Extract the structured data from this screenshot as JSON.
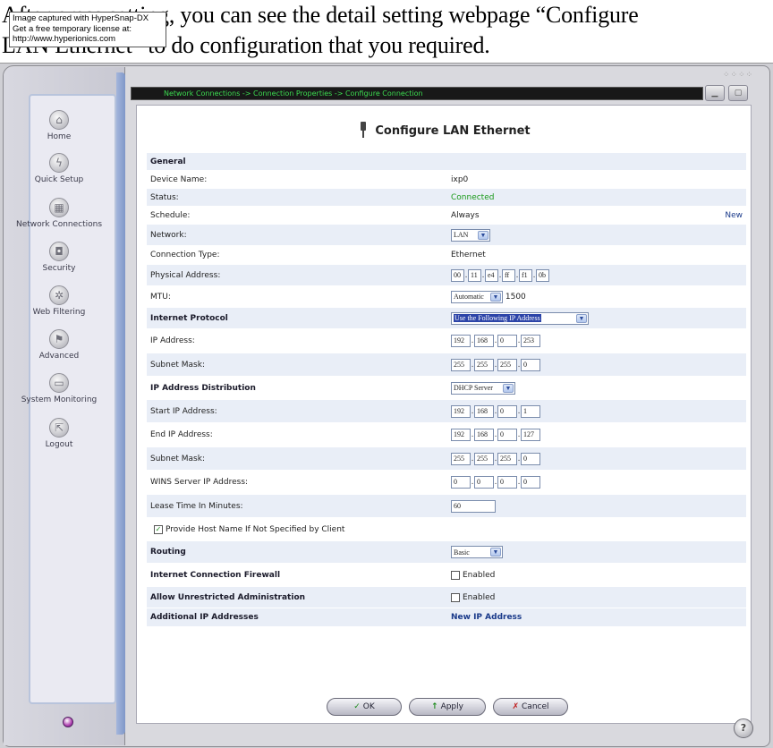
{
  "intro": {
    "line1": "After press setting, you can see the detail setting webpage “Configure",
    "line2": "LAN Ethernet” to do configuration that you required."
  },
  "watermark": {
    "line1": "Image captured with HyperSnap-DX",
    "line2": "Get a free temporary license at:",
    "line3": "http://www.hyperionics.com"
  },
  "breadcrumb": "Network Connections -> Connection Properties -> Configure Connection",
  "sidebar": {
    "items": [
      {
        "label": "Home",
        "icon": "home-icon"
      },
      {
        "label": "Quick Setup",
        "icon": "lightning-icon"
      },
      {
        "label": "Network Connections",
        "icon": "network-icon"
      },
      {
        "label": "Security",
        "icon": "lock-icon"
      },
      {
        "label": "Web Filtering",
        "icon": "filter-icon"
      },
      {
        "label": "Advanced",
        "icon": "advanced-icon"
      },
      {
        "label": "System Monitoring",
        "icon": "monitor-icon"
      },
      {
        "label": "Logout",
        "icon": "logout-icon"
      }
    ]
  },
  "page_title": "Configure LAN Ethernet",
  "form": {
    "general": "General",
    "device_name_label": "Device Name:",
    "device_name_value": "ixp0",
    "status_label": "Status:",
    "status_value": "Connected",
    "schedule_label": "Schedule:",
    "schedule_value": "Always",
    "schedule_new": "New",
    "network_label": "Network:",
    "network_value": "LAN",
    "conn_type_label": "Connection Type:",
    "conn_type_value": "Ethernet",
    "phys_label": "Physical Address:",
    "phys": [
      "00",
      "11",
      "e4",
      "ff",
      "f1",
      "0b"
    ],
    "mtu_label": "MTU:",
    "mtu_mode": "Automatic",
    "mtu_value": "1500",
    "ip_proto_label": "Internet Protocol",
    "ip_proto_value": "Use the Following IP Address",
    "ip_label": "IP Address:",
    "ip": [
      "192",
      "168",
      "0",
      "253"
    ],
    "mask_label": "Subnet Mask:",
    "mask": [
      "255",
      "255",
      "255",
      "0"
    ],
    "dist_label": "IP Address Distribution",
    "dist_value": "DHCP Server",
    "start_label": "Start IP Address:",
    "start": [
      "192",
      "168",
      "0",
      "1"
    ],
    "end_label": "End IP Address:",
    "end": [
      "192",
      "168",
      "0",
      "127"
    ],
    "mask2_label": "Subnet Mask:",
    "mask2": [
      "255",
      "255",
      "255",
      "0"
    ],
    "wins_label": "WINS Server IP Address:",
    "wins": [
      "0",
      "0",
      "0",
      "0"
    ],
    "lease_label": "Lease Time In Minutes:",
    "lease_value": "60",
    "hostname_label": "Provide Host Name If Not Specified by Client",
    "routing_label": "Routing",
    "routing_value": "Basic",
    "firewall_label": "Internet Connection Firewall",
    "firewall_cb": "Enabled",
    "admin_label": "Allow Unrestricted Administration",
    "admin_cb": "Enabled",
    "addl_label": "Additional IP Addresses",
    "addl_link": "New IP Address"
  },
  "buttons": {
    "ok": "OK",
    "apply": "Apply",
    "cancel": "Cancel"
  },
  "help": "?"
}
